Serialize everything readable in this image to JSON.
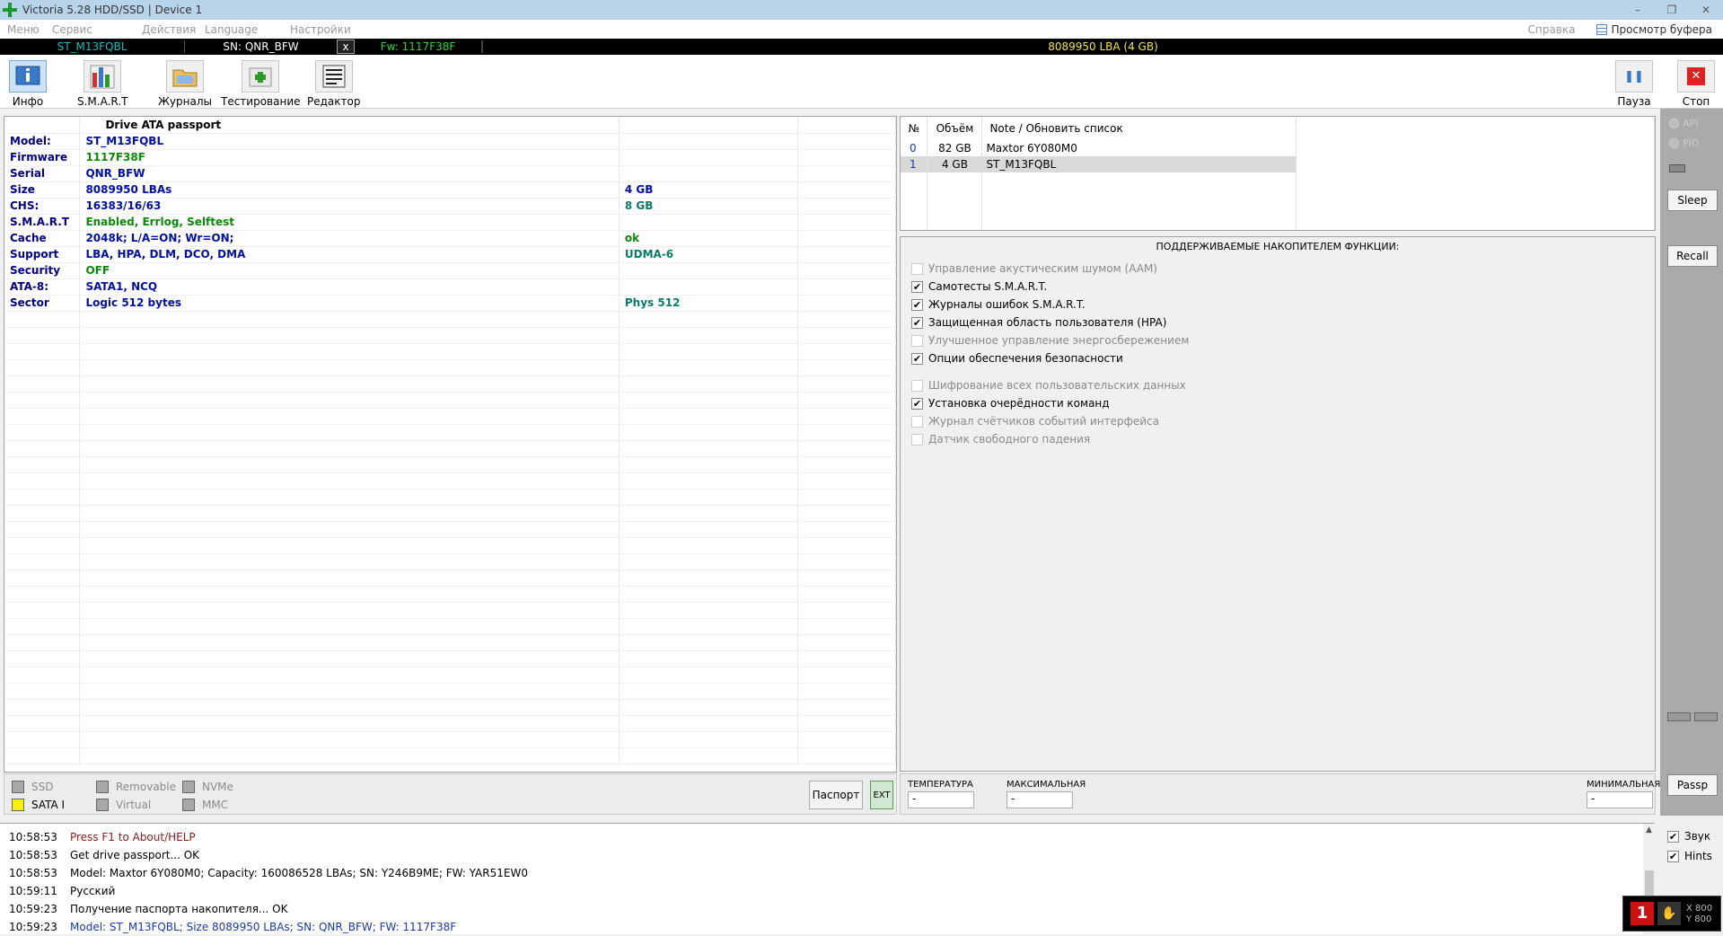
{
  "window": {
    "title": "Victoria 5.28 HDD/SSD | Device 1",
    "min": "–",
    "max": "❐",
    "close": "✕"
  },
  "menu": {
    "items": [
      "Меню",
      "Сервис",
      "Действия",
      "Language",
      "Настройки"
    ],
    "help": "Справка",
    "buffer": "Просмотр буфера"
  },
  "infobar": {
    "model": "ST_M13FQBL",
    "serial": "SN: QNR_BFW",
    "close": "x",
    "firmware": "Fw: 1117F38F",
    "size": "8089950 LBA (4 GB)"
  },
  "toolbar": {
    "info": "Инфо",
    "smart": "S.M.A.R.T",
    "logs": "Журналы",
    "test": "Тестирование",
    "editor": "Редактор",
    "pause": "Пауза",
    "stop": "Стоп",
    "stop_icon": "✕",
    "pause_icon": "❚❚",
    "plus_icon": "+"
  },
  "passport": {
    "header": "Drive ATA passport",
    "rows": [
      {
        "label": "Model:",
        "value": "ST_M13FQBL",
        "extra": ""
      },
      {
        "label": "Firmware",
        "value": "1117F38F",
        "extra": ""
      },
      {
        "label": "Serial",
        "value": "QNR_BFW",
        "extra": ""
      },
      {
        "label": "Size",
        "value": "8089950 LBAs",
        "extra": "4 GB"
      },
      {
        "label": "CHS:",
        "value": "16383/16/63",
        "extra": "8 GB"
      },
      {
        "label": "S.M.A.R.T",
        "value": "Enabled, Errlog, Selftest",
        "extra": ""
      },
      {
        "label": "Cache",
        "value": "2048k; L/A=ON; Wr=ON;",
        "extra": "ok"
      },
      {
        "label": "Support",
        "value": "LBA, HPA, DLM, DCO, DMA",
        "extra": "UDMA-6"
      },
      {
        "label": "Security",
        "value": "OFF",
        "extra": ""
      },
      {
        "label": "ATA-8:",
        "value": "SATA1, NCQ",
        "extra": ""
      },
      {
        "label": "Sector",
        "value": "Logic 512 bytes",
        "extra": "Phys 512"
      }
    ]
  },
  "flags": {
    "ssd": "SSD",
    "removable": "Removable",
    "nvme": "NVMe",
    "sata": "SATA I",
    "virtual": "Virtual",
    "mmc": "MMC",
    "passport_btn": "Паспорт",
    "ext_btn": "EXT"
  },
  "drives": {
    "headers": {
      "num": "№",
      "size": "Объём",
      "note": "Note / Обновить список"
    },
    "rows": [
      {
        "num": "0",
        "size": "82 GB",
        "note": "Maxtor 6Y080M0"
      },
      {
        "num": "1",
        "size": "4 GB",
        "note": "ST_M13FQBL"
      }
    ]
  },
  "functions": {
    "header": "ПОДДЕРЖИВАЕМЫЕ НАКОПИТЕЛЕМ ФУНКЦИИ:",
    "group1": [
      {
        "label": "Управление акустическим шумом (AAM)",
        "checked": false
      },
      {
        "label": "Самотесты S.M.A.R.T.",
        "checked": true
      },
      {
        "label": "Журналы ошибок S.M.A.R.T.",
        "checked": true
      },
      {
        "label": "Защищенная область пользователя (HPA)",
        "checked": true
      },
      {
        "label": "Улучшенное управление энергосбережением",
        "checked": false
      },
      {
        "label": "Опции обеспечения безопасности",
        "checked": true
      }
    ],
    "group2": [
      {
        "label": "Шифрование всех пользовательских данных",
        "checked": false
      },
      {
        "label": "Установка очерёдности команд",
        "checked": true
      },
      {
        "label": "Журнал счётчиков событий интерфейса",
        "checked": false
      },
      {
        "label": "Датчик свободного падения",
        "checked": false
      }
    ]
  },
  "temps": {
    "temp_label": "ТЕМПЕРАТУРА",
    "temp_value": "-",
    "max_label": "МАКСИМАЛЬНАЯ",
    "max_value": "-",
    "min_label": "МИНИМАЛЬНАЯ",
    "min_value": "-"
  },
  "sidebar": {
    "api": "API",
    "pio": "PIO",
    "sleep": "Sleep",
    "recall": "Recall",
    "passp": "Passp"
  },
  "log": [
    {
      "time": "10:58:53",
      "text": "Press F1 to About/HELP",
      "color": "#8b1a1a"
    },
    {
      "time": "10:58:53",
      "text": "Get drive passport... OK",
      "color": "#000000"
    },
    {
      "time": "10:58:53",
      "text": "Model: Maxtor 6Y080M0; Capacity: 160086528 LBAs; SN: Y246B9ME; FW: YAR51EW0",
      "color": "#000000"
    },
    {
      "time": "10:59:11",
      "text": "Русский",
      "color": "#000000"
    },
    {
      "time": "10:59:23",
      "text": "Получение паспорта накопителя... OK",
      "color": "#000000"
    },
    {
      "time": "10:59:23",
      "text": "Model: ST_M13FQBL; Size 8089950 LBAs; SN: QNR_BFW; FW: 1117F38F",
      "color": "#1a3aa8"
    }
  ],
  "options": {
    "sound": "Звук",
    "hints": "Hints"
  },
  "mini": {
    "num": "1",
    "x": "X 800",
    "y": "Y 800",
    "icon": "✋"
  },
  "check_mark": "✔"
}
